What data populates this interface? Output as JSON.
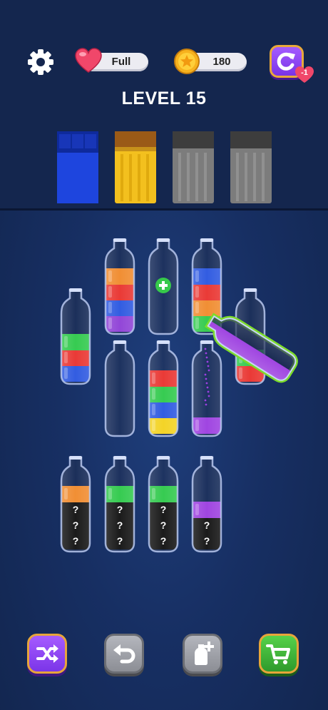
{
  "header": {
    "lives_status": "Full",
    "coin_count": "180",
    "restart_penalty": "-1",
    "level_title": "LEVEL 15"
  },
  "goal_boxes": [
    {
      "color": "#1a3fd1",
      "state": "complete"
    },
    {
      "color": "#f3c01e",
      "state": "complete"
    },
    {
      "color": "#6e6e6e",
      "state": "locked"
    },
    {
      "color": "#6e6e6e",
      "state": "locked"
    }
  ],
  "bottles": {
    "row1": [
      {
        "layers": [
          "#f08a2c",
          "#e9322e",
          "#2a56e0",
          "#8e3fd6"
        ]
      },
      {
        "layers": [],
        "extra_slot": true
      },
      {
        "layers": [
          "#2a56e0",
          "#e9322e",
          "#f08a2c",
          "#2ec94a"
        ]
      }
    ],
    "row2": [
      {
        "layers": [
          "#2ec94a",
          "#e9322e",
          "#2a56e0"
        ]
      },
      {
        "layers": []
      },
      {
        "layers": [
          "#e9322e",
          "#2ec94a",
          "#2a56e0",
          "#f3d21e"
        ]
      },
      {
        "layers": [
          "#9c3ee0"
        ],
        "receiving_pour": true
      },
      {
        "layers": [
          "#2ec94a",
          "#e9322e"
        ],
        "partially_hidden": true
      }
    ],
    "row3": [
      {
        "layers": [
          "#f08a2c"
        ],
        "hidden_layers": 3
      },
      {
        "layers": [
          "#2ec94a"
        ],
        "hidden_layers": 3
      },
      {
        "layers": [
          "#2ec94a"
        ],
        "hidden_layers": 3
      },
      {
        "layers": [
          "#9c3ee0"
        ],
        "hidden_layers": 2
      }
    ],
    "pouring_bottle": {
      "color": "#9c3ee0",
      "highlight": "#7ddc2a"
    },
    "hidden_marker": "?"
  },
  "toolbar": {
    "shuffle_icon": "shuffle-icon",
    "undo_icon": "undo-icon",
    "add_bottle_icon": "add-bottle-icon",
    "shop_icon": "shopping-cart-icon"
  }
}
